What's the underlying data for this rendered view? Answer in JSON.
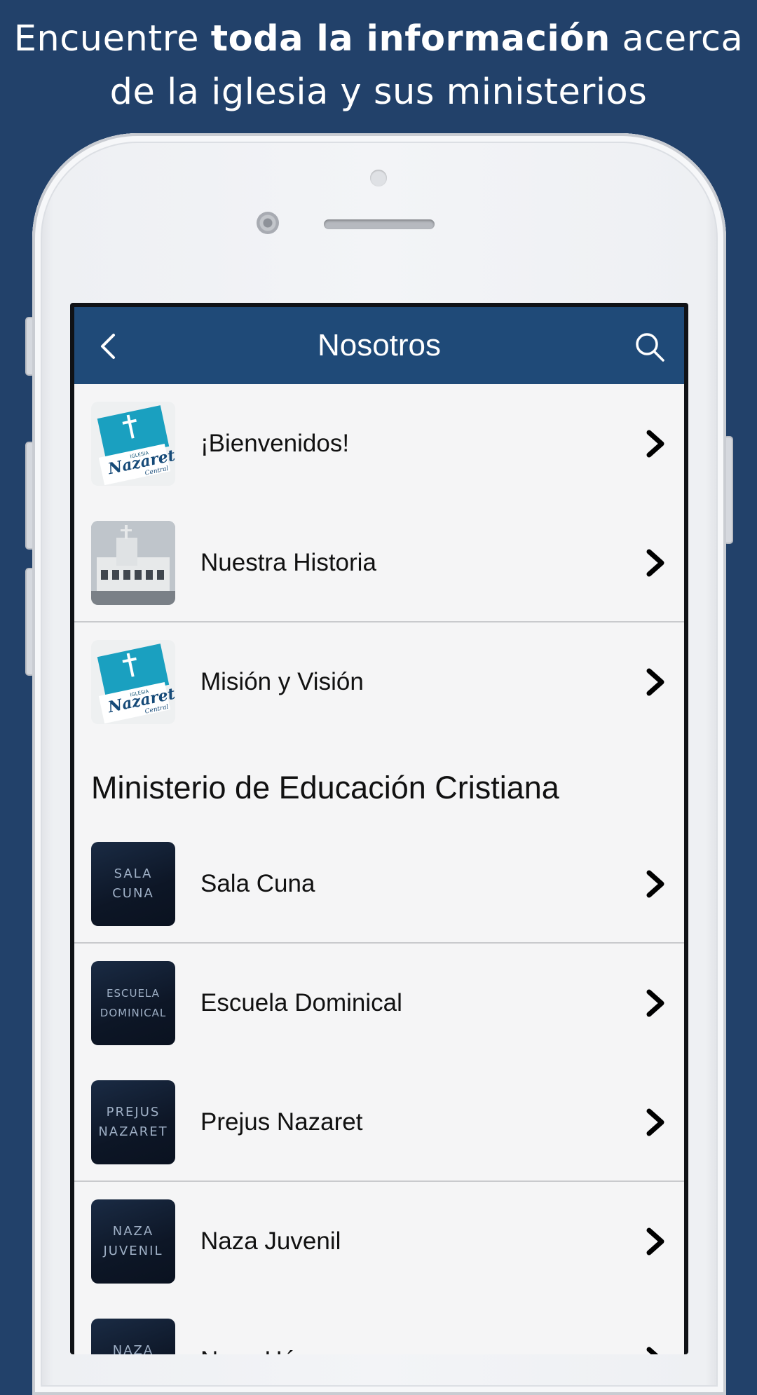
{
  "promo": {
    "before": "Encuentre ",
    "bold": "toda la información",
    "after": " acerca de la iglesia y sus ministerios"
  },
  "navbar": {
    "title": "Nosotros",
    "back_icon": "chevron-left-icon",
    "search_icon": "search-icon"
  },
  "items_top": [
    {
      "label": "¡Bienvenidos!",
      "thumb": "logo"
    },
    {
      "label": "Nuestra Historia",
      "thumb": "photo"
    },
    {
      "label": "Misión y Visión",
      "thumb": "logo"
    }
  ],
  "section": {
    "title": "Ministerio de Educación Cristiana"
  },
  "items_section": [
    {
      "label": "Sala Cuna",
      "thumb_text": "SALA\nCUNA"
    },
    {
      "label": "Escuela Dominical",
      "thumb_text": "ESCUELA\nDOMINICAL"
    },
    {
      "label": "Prejus Nazaret",
      "thumb_text": "PREJUS\nNAZARET"
    },
    {
      "label": "Naza Juvenil",
      "thumb_text": "NAZA\nJUVENIL"
    },
    {
      "label": "Naza Héroes",
      "thumb_text": "NAZA\nHÉROES"
    }
  ],
  "logo": {
    "line1": "IGLESIA",
    "line2": "Nazaret",
    "line3": "Central"
  },
  "colors": {
    "background": "#22416a",
    "navbar": "#1f4a78",
    "logo_teal": "#1aa0c0"
  }
}
